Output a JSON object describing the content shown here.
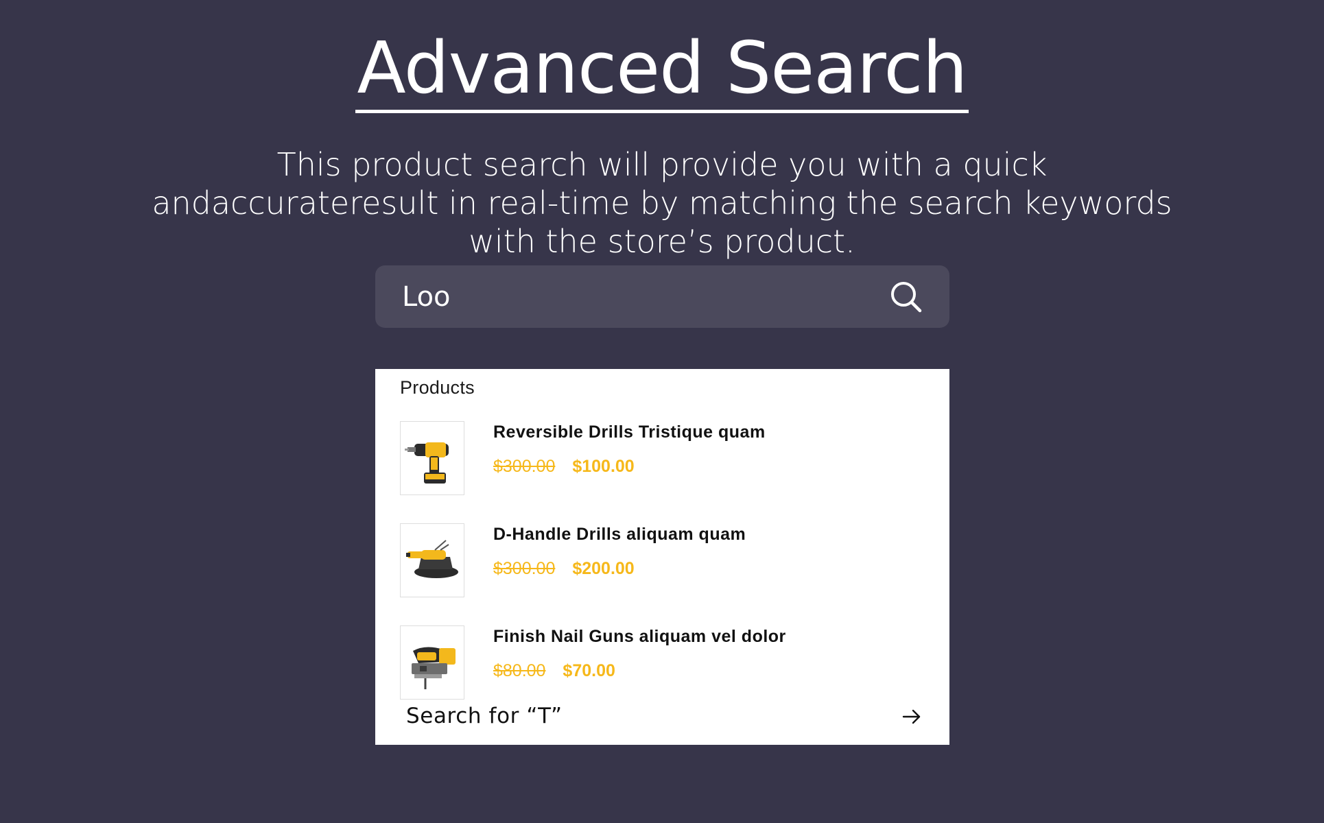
{
  "header": {
    "title": "Advanced Search",
    "subtitle": "This product search will provide you with a quick andaccurateresult in real-time by matching the search keywords with the store’s product."
  },
  "search": {
    "value": "Loo",
    "icon": "search-icon"
  },
  "results": {
    "section_label": "Products",
    "items": [
      {
        "name": "Reversible Drills Tristique quam",
        "old_price": "$300.00",
        "new_price": "$100.00",
        "icon": "drill-icon"
      },
      {
        "name": "D-Handle Drills aliquam quam",
        "old_price": "$300.00",
        "new_price": "$200.00",
        "icon": "sander-icon"
      },
      {
        "name": "Finish Nail Guns aliquam vel dolor",
        "old_price": "$80.00",
        "new_price": "$70.00",
        "icon": "jigsaw-icon"
      }
    ],
    "search_for_label": "Search for “T”",
    "arrow_icon": "arrow-right-icon"
  },
  "colors": {
    "background": "#37354a",
    "search_bar": "#4b495c",
    "price_accent": "#f6b81a",
    "panel": "#ffffff"
  }
}
